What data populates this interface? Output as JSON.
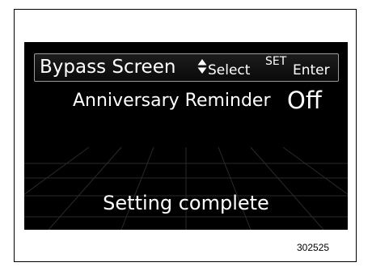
{
  "header": {
    "title": "Bypass Screen",
    "select_label": "Select",
    "set_label": "SET",
    "enter_label": "Enter"
  },
  "setting": {
    "label": "Anniversary Reminder",
    "value": "Off"
  },
  "status": "Setting complete",
  "figure_id": "302525",
  "colors": {
    "screen_background": "#000000",
    "text": "#ffffff",
    "header_border": "#9a9a9a"
  },
  "icons": [
    "up-down-arrows-icon"
  ]
}
